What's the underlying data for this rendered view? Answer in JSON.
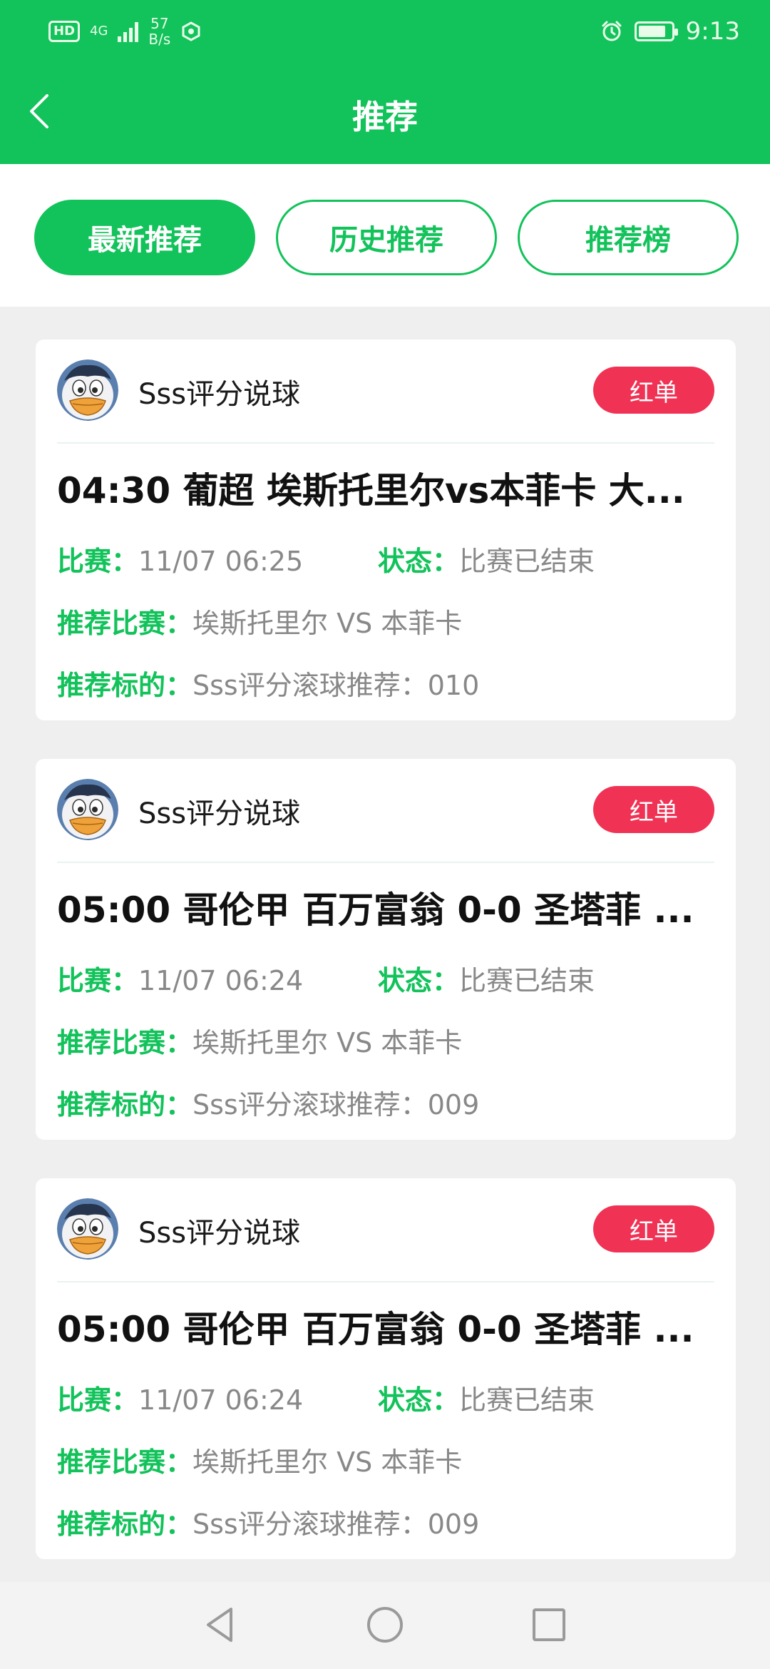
{
  "status_bar": {
    "hd": "HD",
    "network": "4G",
    "speed_value": "57",
    "speed_unit": "B/s",
    "time": "9:13",
    "battery_level": 0.85
  },
  "header": {
    "title": "推荐",
    "accent_color": "#12c25a"
  },
  "tabs": [
    {
      "label": "最新推荐",
      "active": true
    },
    {
      "label": "历史推荐",
      "active": false
    },
    {
      "label": "推荐榜",
      "active": false
    }
  ],
  "labels": {
    "match_time": "比赛：",
    "status": "状态：",
    "recommend_match": "推荐比赛：",
    "recommend_target": "推荐标的："
  },
  "cards": [
    {
      "author": "Sss评分说球",
      "badge": "红单",
      "title": "04:30 葡超 埃斯托里尔vs本菲卡 大...",
      "match_time": "11/07 06:25",
      "status": "比赛已结束",
      "recommend_match": "埃斯托里尔 VS 本菲卡",
      "recommend_target": "Sss评分滚球推荐：010"
    },
    {
      "author": "Sss评分说球",
      "badge": "红单",
      "title": "05:00 哥伦甲 百万富翁 0-0 圣塔菲 ...",
      "match_time": "11/07 06:24",
      "status": "比赛已结束",
      "recommend_match": "埃斯托里尔 VS 本菲卡",
      "recommend_target": "Sss评分滚球推荐：009"
    },
    {
      "author": "Sss评分说球",
      "badge": "红单",
      "title": "05:00 哥伦甲 百万富翁 0-0 圣塔菲 ...",
      "match_time": "11/07 06:24",
      "status": "比赛已结束",
      "recommend_match": "埃斯托里尔 VS 本菲卡",
      "recommend_target": "Sss评分滚球推荐：009"
    }
  ],
  "icons": {
    "back": "chevron-left-icon",
    "avatar": "duck-avatar-icon",
    "nav_back": "triangle-back-icon",
    "nav_home": "circle-home-icon",
    "nav_recent": "square-recent-icon"
  }
}
